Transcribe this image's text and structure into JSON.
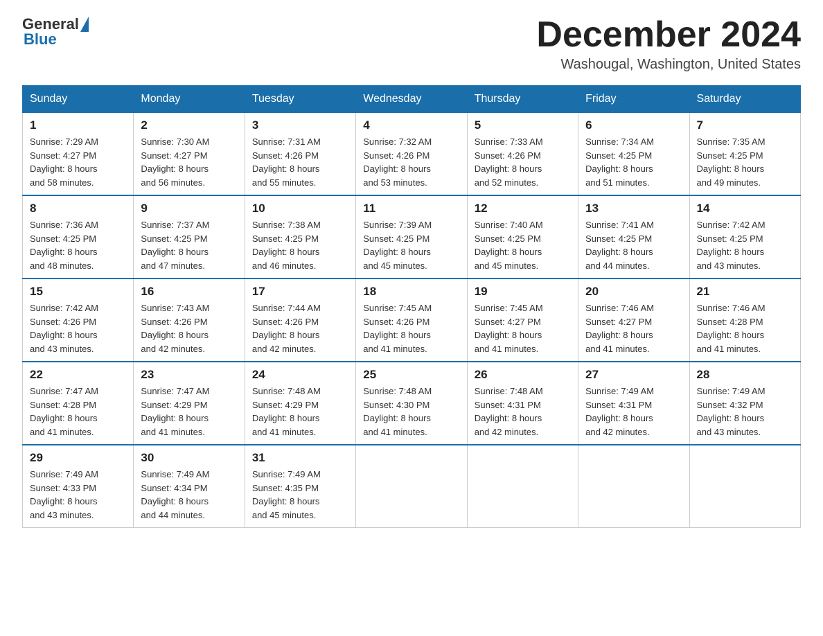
{
  "header": {
    "logo_text_general": "General",
    "logo_text_blue": "Blue",
    "month_title": "December 2024",
    "location": "Washougal, Washington, United States"
  },
  "weekdays": [
    "Sunday",
    "Monday",
    "Tuesday",
    "Wednesday",
    "Thursday",
    "Friday",
    "Saturday"
  ],
  "weeks": [
    [
      {
        "day": "1",
        "sunrise": "7:29 AM",
        "sunset": "4:27 PM",
        "daylight": "8 hours and 58 minutes."
      },
      {
        "day": "2",
        "sunrise": "7:30 AM",
        "sunset": "4:27 PM",
        "daylight": "8 hours and 56 minutes."
      },
      {
        "day": "3",
        "sunrise": "7:31 AM",
        "sunset": "4:26 PM",
        "daylight": "8 hours and 55 minutes."
      },
      {
        "day": "4",
        "sunrise": "7:32 AM",
        "sunset": "4:26 PM",
        "daylight": "8 hours and 53 minutes."
      },
      {
        "day": "5",
        "sunrise": "7:33 AM",
        "sunset": "4:26 PM",
        "daylight": "8 hours and 52 minutes."
      },
      {
        "day": "6",
        "sunrise": "7:34 AM",
        "sunset": "4:25 PM",
        "daylight": "8 hours and 51 minutes."
      },
      {
        "day": "7",
        "sunrise": "7:35 AM",
        "sunset": "4:25 PM",
        "daylight": "8 hours and 49 minutes."
      }
    ],
    [
      {
        "day": "8",
        "sunrise": "7:36 AM",
        "sunset": "4:25 PM",
        "daylight": "8 hours and 48 minutes."
      },
      {
        "day": "9",
        "sunrise": "7:37 AM",
        "sunset": "4:25 PM",
        "daylight": "8 hours and 47 minutes."
      },
      {
        "day": "10",
        "sunrise": "7:38 AM",
        "sunset": "4:25 PM",
        "daylight": "8 hours and 46 minutes."
      },
      {
        "day": "11",
        "sunrise": "7:39 AM",
        "sunset": "4:25 PM",
        "daylight": "8 hours and 45 minutes."
      },
      {
        "day": "12",
        "sunrise": "7:40 AM",
        "sunset": "4:25 PM",
        "daylight": "8 hours and 45 minutes."
      },
      {
        "day": "13",
        "sunrise": "7:41 AM",
        "sunset": "4:25 PM",
        "daylight": "8 hours and 44 minutes."
      },
      {
        "day": "14",
        "sunrise": "7:42 AM",
        "sunset": "4:25 PM",
        "daylight": "8 hours and 43 minutes."
      }
    ],
    [
      {
        "day": "15",
        "sunrise": "7:42 AM",
        "sunset": "4:26 PM",
        "daylight": "8 hours and 43 minutes."
      },
      {
        "day": "16",
        "sunrise": "7:43 AM",
        "sunset": "4:26 PM",
        "daylight": "8 hours and 42 minutes."
      },
      {
        "day": "17",
        "sunrise": "7:44 AM",
        "sunset": "4:26 PM",
        "daylight": "8 hours and 42 minutes."
      },
      {
        "day": "18",
        "sunrise": "7:45 AM",
        "sunset": "4:26 PM",
        "daylight": "8 hours and 41 minutes."
      },
      {
        "day": "19",
        "sunrise": "7:45 AM",
        "sunset": "4:27 PM",
        "daylight": "8 hours and 41 minutes."
      },
      {
        "day": "20",
        "sunrise": "7:46 AM",
        "sunset": "4:27 PM",
        "daylight": "8 hours and 41 minutes."
      },
      {
        "day": "21",
        "sunrise": "7:46 AM",
        "sunset": "4:28 PM",
        "daylight": "8 hours and 41 minutes."
      }
    ],
    [
      {
        "day": "22",
        "sunrise": "7:47 AM",
        "sunset": "4:28 PM",
        "daylight": "8 hours and 41 minutes."
      },
      {
        "day": "23",
        "sunrise": "7:47 AM",
        "sunset": "4:29 PM",
        "daylight": "8 hours and 41 minutes."
      },
      {
        "day": "24",
        "sunrise": "7:48 AM",
        "sunset": "4:29 PM",
        "daylight": "8 hours and 41 minutes."
      },
      {
        "day": "25",
        "sunrise": "7:48 AM",
        "sunset": "4:30 PM",
        "daylight": "8 hours and 41 minutes."
      },
      {
        "day": "26",
        "sunrise": "7:48 AM",
        "sunset": "4:31 PM",
        "daylight": "8 hours and 42 minutes."
      },
      {
        "day": "27",
        "sunrise": "7:49 AM",
        "sunset": "4:31 PM",
        "daylight": "8 hours and 42 minutes."
      },
      {
        "day": "28",
        "sunrise": "7:49 AM",
        "sunset": "4:32 PM",
        "daylight": "8 hours and 43 minutes."
      }
    ],
    [
      {
        "day": "29",
        "sunrise": "7:49 AM",
        "sunset": "4:33 PM",
        "daylight": "8 hours and 43 minutes."
      },
      {
        "day": "30",
        "sunrise": "7:49 AM",
        "sunset": "4:34 PM",
        "daylight": "8 hours and 44 minutes."
      },
      {
        "day": "31",
        "sunrise": "7:49 AM",
        "sunset": "4:35 PM",
        "daylight": "8 hours and 45 minutes."
      },
      null,
      null,
      null,
      null
    ]
  ],
  "labels": {
    "sunrise": "Sunrise:",
    "sunset": "Sunset:",
    "daylight": "Daylight:"
  }
}
